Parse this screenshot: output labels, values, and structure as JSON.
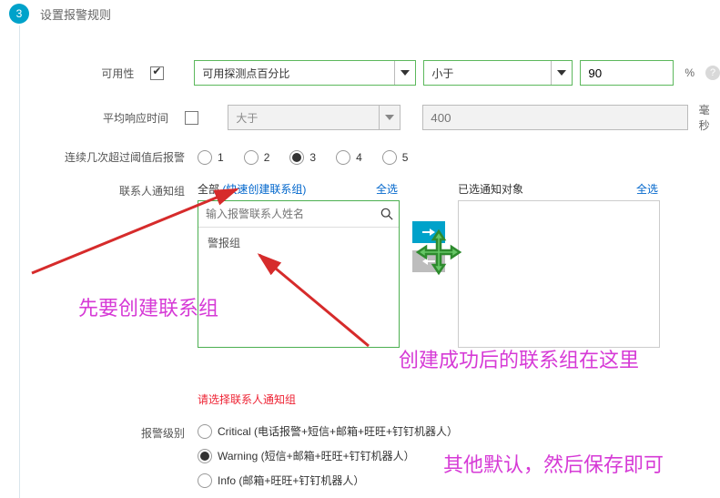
{
  "step": {
    "number": "3",
    "title": "设置报警规则"
  },
  "rows": {
    "availability": {
      "label": "可用性",
      "checked": true,
      "metric": "可用探测点百分比",
      "operator": "小于",
      "threshold": "90",
      "unit": "%"
    },
    "avgResponse": {
      "label": "平均响应时间",
      "checked": false,
      "operator": "大于",
      "threshold_placeholder": "400",
      "unit": "毫秒"
    },
    "consecutive": {
      "label": "连续几次超过阈值后报警",
      "options": [
        "1",
        "2",
        "3",
        "4",
        "5"
      ],
      "selected": "3"
    },
    "contactGroup": {
      "label": "联系人通知组",
      "all_text": "全部",
      "quick_create": "(快速创建联系组)",
      "select_all": "全选",
      "search_placeholder": "输入报警联系人姓名",
      "items": [
        "警报组"
      ],
      "selected_title": "已选通知对象"
    },
    "error_text": "请选择联系人通知组",
    "alarmLevel": {
      "label": "报警级别",
      "options": [
        {
          "name": "critical",
          "label": "Critical (电话报警+短信+邮箱+旺旺+钉钉机器人）"
        },
        {
          "name": "warning",
          "label": "Warning (短信+邮箱+旺旺+钉钉机器人）"
        },
        {
          "name": "info",
          "label": "Info (邮箱+旺旺+钉钉机器人）"
        }
      ],
      "selected": "warning"
    }
  },
  "annotations": {
    "a1": "先要创建联系组",
    "a2": "创建成功后的联系组在这里",
    "a3": "其他默认，然后保存即可"
  }
}
